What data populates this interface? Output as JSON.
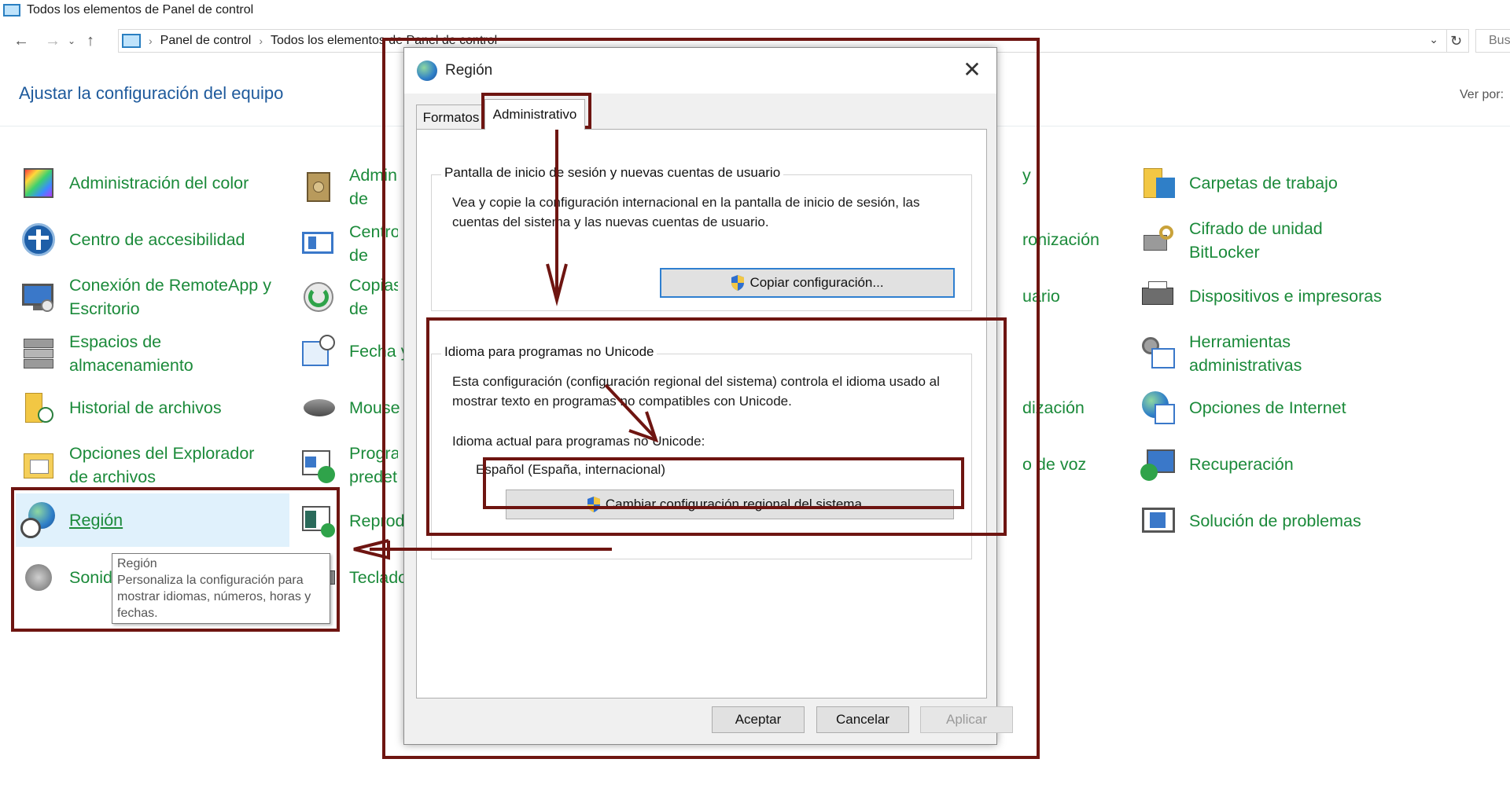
{
  "window": {
    "title": "Todos los elementos de Panel de control"
  },
  "address_bar": {
    "crumbs": [
      "Panel de control",
      "Todos los elementos de Panel de control"
    ],
    "search_placeholder": "Bus"
  },
  "header": {
    "title": "Ajustar la configuración del equipo",
    "view_by_label": "Ver por:"
  },
  "columns": {
    "col1": [
      "Administración del color",
      "Centro de accesibilidad",
      "Conexión de RemoteApp y Escritorio",
      "Espacios de almacenamiento",
      "Historial de archivos",
      "Opciones del Explorador de archivos",
      "Región",
      "Sonido"
    ],
    "col2": [
      "Administrador de credenciales",
      "Centro de movilidad de Windows",
      "Copias de seguridad y restauración",
      "Fecha y hora",
      "Mouse",
      "Programas predeterminados",
      "Reproducción automática",
      "Teclado"
    ],
    "col3_visible": [
      "y",
      "ronización",
      "uario",
      "dización",
      "o de voz"
    ],
    "col4": [
      "Carpetas de trabajo",
      "Cifrado de unidad BitLocker",
      "Dispositivos e impresoras",
      "Herramientas administrativas",
      "Opciones de Internet",
      "Recuperación",
      "Solución de problemas"
    ]
  },
  "tooltip": {
    "title": "Región",
    "text": "Personaliza la configuración para mostrar idiomas, números, horas y fechas."
  },
  "dialog": {
    "title": "Región",
    "tabs": [
      "Formatos",
      "Administrativo"
    ],
    "active_tab": "Administrativo",
    "group1": {
      "legend": "Pantalla de inicio de sesión y nuevas cuentas de usuario",
      "text": "Vea y copie la configuración internacional en la pantalla de inicio de sesión, las cuentas del sistema y las nuevas cuentas de usuario.",
      "button": "Copiar configuración..."
    },
    "group2": {
      "legend": "Idioma para programas no Unicode",
      "text": "Esta configuración (configuración regional del sistema) controla el idioma usado al mostrar texto en programas no compatibles con Unicode.",
      "current_label": "Idioma actual para programas no Unicode:",
      "current_value": "Español (España, internacional)",
      "button": "Cambiar configuración regional del sistema..."
    },
    "footer": {
      "ok": "Aceptar",
      "cancel": "Cancelar",
      "apply": "Aplicar"
    }
  },
  "colors": {
    "link_green": "#1b8a3a",
    "heading_blue": "#1e5a9c",
    "annotation_red": "#6e1511",
    "selection_blue": "#e0f1fc"
  }
}
